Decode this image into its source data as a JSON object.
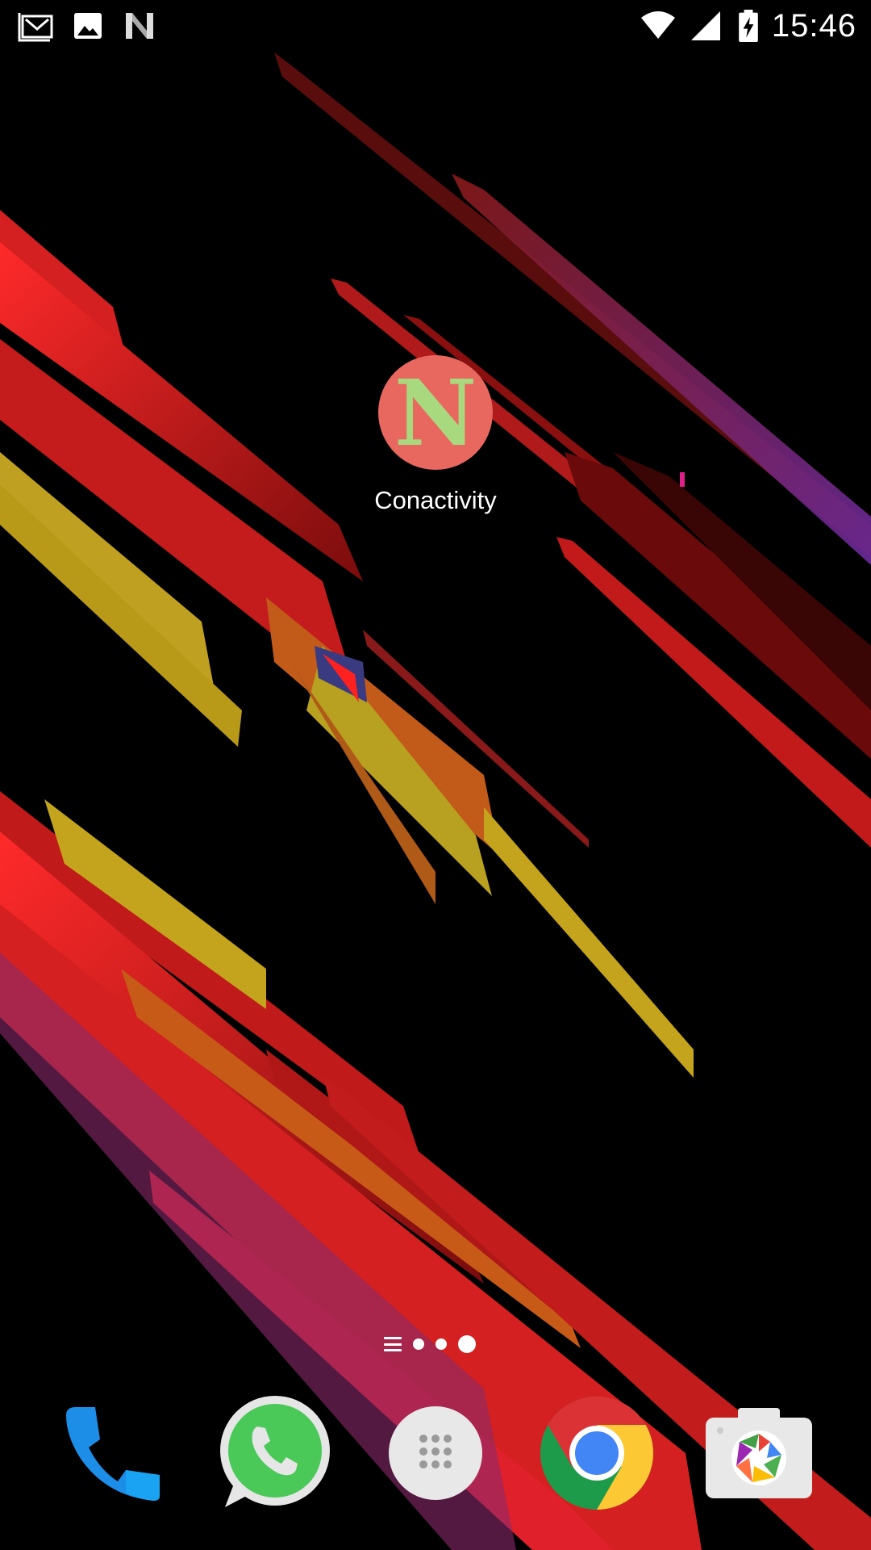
{
  "status_bar": {
    "notification_icons": [
      "gmail-icon",
      "gallery-icon",
      "nova-launcher-icon"
    ],
    "system_icons": [
      "wifi-icon",
      "signal-icon",
      "battery-charging-icon"
    ],
    "time": "15:46"
  },
  "home_screen": {
    "shortcut": {
      "label": "Conactivity",
      "icon_letter": "N",
      "icon_bg": "#e8675f",
      "icon_fg": "#a9d97f"
    },
    "page_indicator": {
      "pages": 3,
      "active_page": 3,
      "has_menu": true
    }
  },
  "dock": {
    "items": [
      {
        "name": "phone",
        "icon": "phone-icon"
      },
      {
        "name": "whatsapp",
        "icon": "whatsapp-icon"
      },
      {
        "name": "app-drawer",
        "icon": "app-drawer-icon"
      },
      {
        "name": "chrome",
        "icon": "chrome-icon"
      },
      {
        "name": "camera",
        "icon": "camera-icon"
      }
    ]
  },
  "colors": {
    "wallpaper_base": "#000000",
    "streak_red": "#e0232a",
    "streak_yellow": "#c9a81c",
    "streak_purple": "#7a2a8a"
  }
}
